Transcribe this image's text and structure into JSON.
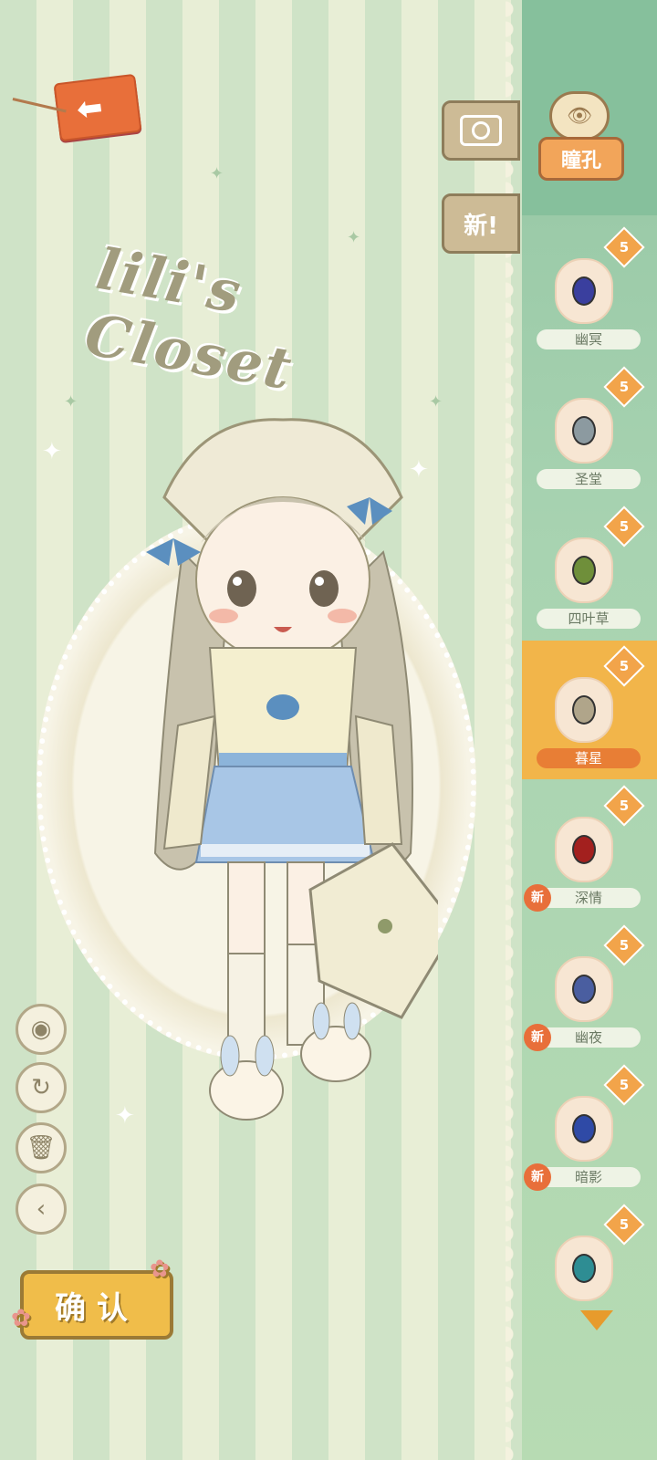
{
  "title": "lili's Closet",
  "back_icon": "arrow-left-icon",
  "buttons": {
    "camera_icon": "camera-icon",
    "new_label": "新!",
    "confirm_label": "确认"
  },
  "tools": [
    {
      "name": "hide-icon",
      "glyph": "◉"
    },
    {
      "name": "reset-icon",
      "glyph": "↻"
    },
    {
      "name": "trash-icon",
      "glyph": "🗑"
    },
    {
      "name": "collapse-icon",
      "glyph": "‹"
    }
  ],
  "sidebar": {
    "category_label": "瞳孔",
    "items": [
      {
        "label": "幽冥",
        "level": "5",
        "new": false,
        "color": "#3a3f9e"
      },
      {
        "label": "圣堂",
        "level": "5",
        "new": false,
        "color": "#8c9aa0"
      },
      {
        "label": "四叶草",
        "level": "5",
        "new": false,
        "color": "#6f8f3a"
      },
      {
        "label": "暮星",
        "level": "5",
        "new": false,
        "color": "#b0a58a",
        "selected": true
      },
      {
        "label": "深情",
        "level": "5",
        "new": true,
        "color": "#a3201e"
      },
      {
        "label": "幽夜",
        "level": "5",
        "new": true,
        "color": "#4a5ea0"
      },
      {
        "label": "暗影",
        "level": "5",
        "new": true,
        "color": "#2f4aa6"
      },
      {
        "label": "",
        "level": "5",
        "new": false,
        "color": "#2e8d93"
      }
    ],
    "new_tag": "新"
  }
}
